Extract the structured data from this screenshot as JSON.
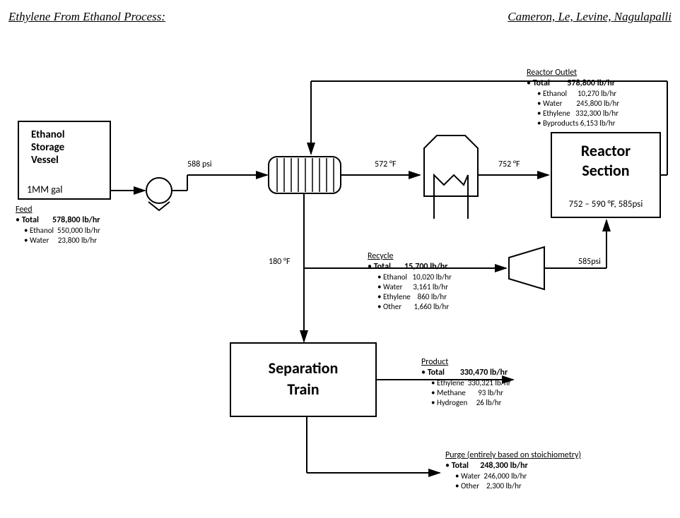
{
  "header": {
    "title": "Ethylene From Ethanol Process:",
    "authors": "Cameron, Le, Levine, Nagulapalli"
  },
  "storage": {
    "title1": "Ethanol",
    "title2": "Storage",
    "title3": "Vessel",
    "capacity": "1MM gal"
  },
  "pump": {
    "pressure": "588 psi"
  },
  "hex": {
    "out_temp": "572 °F",
    "cold_in_temp": "180 °F"
  },
  "furnace": {
    "out_temp": "752 °F"
  },
  "reactor": {
    "title1": "Reactor",
    "title2": "Section",
    "conditions": "752 – 590 °F, 585psi"
  },
  "recycle_comp": {
    "pressure": "585psi"
  },
  "separation": {
    "title1": "Separation",
    "title2": "Train"
  },
  "streams": {
    "feed": {
      "heading": "Feed",
      "total_label": "Total",
      "total_value": "578,800 lb/hr",
      "rows": [
        {
          "name": "Ethanol",
          "value": "550,000 lb/hr"
        },
        {
          "name": "Water",
          "value": "23,800 lb/hr"
        }
      ]
    },
    "reactor_outlet": {
      "heading": "Reactor Outlet",
      "total_label": "Total",
      "total_value": "578,800 lb/hr",
      "rows": [
        {
          "name": "Ethanol",
          "value": "10,270 lb/hr"
        },
        {
          "name": "Water",
          "value": "245,800 lb/hr"
        },
        {
          "name": "Ethylene",
          "value": "332,300 lb/hr"
        },
        {
          "name": "Byproducts",
          "value": "6,153 lb/hr"
        }
      ]
    },
    "recycle": {
      "heading": "Recycle",
      "total_label": "Total",
      "total_value": "15,700 lb/hr",
      "rows": [
        {
          "name": "Ethanol",
          "value": "10,020 lb/hr"
        },
        {
          "name": "Water",
          "value": "3,161 lb/hr"
        },
        {
          "name": "Ethylene",
          "value": "860 lb/hr"
        },
        {
          "name": "Other",
          "value": "1,660 lb/hr"
        }
      ]
    },
    "product": {
      "heading": "Product",
      "total_label": "Total",
      "total_value": "330,470 lb/hr",
      "rows": [
        {
          "name": "Ethylene",
          "value": "330,321 lb/hr"
        },
        {
          "name": "Methane",
          "value": "93 lb/hr"
        },
        {
          "name": "Hydrogen",
          "value": "26 lb/hr"
        }
      ]
    },
    "purge": {
      "heading": "Purge (entirely based on stoichiometry)",
      "total_label": "Total",
      "total_value": "248,300 lb/hr",
      "rows": [
        {
          "name": "Water",
          "value": "246,000 lb/hr"
        },
        {
          "name": "Other",
          "value": "2,300 lb/hr"
        }
      ]
    }
  }
}
